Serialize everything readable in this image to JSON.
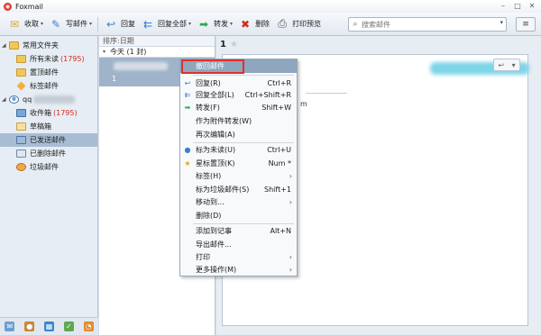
{
  "app": {
    "title": "Foxmail",
    "logo_icon": "foxmail-logo-icon"
  },
  "window_controls": [
    "minimize",
    "maximize",
    "close"
  ],
  "toolbar": {
    "receive": {
      "label": "收取",
      "icon": "receive-icon"
    },
    "compose": {
      "label": "写邮件",
      "icon": "compose-icon"
    },
    "reply": {
      "label": "回复",
      "icon": "reply-icon"
    },
    "reply_all": {
      "label": "回复全部",
      "icon": "reply-all-icon"
    },
    "forward": {
      "label": "转发",
      "icon": "forward-icon"
    },
    "delete": {
      "label": "删除",
      "icon": "delete-icon"
    },
    "print_preview": {
      "label": "打印预览",
      "icon": "print-icon"
    }
  },
  "search": {
    "placeholder": "搜索邮件"
  },
  "sidebar": {
    "common_folder": "常用文件夹",
    "all_unread": "所有未读",
    "all_unread_count": "(1795)",
    "starred": "置顶邮件",
    "tagged": "标签邮件",
    "account_prefix": "qq",
    "inbox": "收件箱",
    "inbox_count": "(1795)",
    "drafts": "草稿箱",
    "sent": "已发送邮件",
    "deleted": "已删除邮件",
    "spam": "垃圾邮件"
  },
  "maillist": {
    "sort_label": "排序:日期",
    "group_label": "今天 (1 封)",
    "item_count": "1"
  },
  "reader": {
    "count": "1",
    "body_fragment": "m"
  },
  "context_menu": {
    "recall": "撤回邮件",
    "items": [
      {
        "label": "回复(R)",
        "shortcut": "Ctrl+R",
        "icon": "reply-icon"
      },
      {
        "label": "回复全部(L)",
        "shortcut": "Ctrl+Shift+R",
        "icon": "reply-all-icon"
      },
      {
        "label": "转发(F)",
        "shortcut": "Shift+W",
        "icon": "forward-icon"
      },
      {
        "label": "作为附件转发(W)",
        "shortcut": "",
        "icon": ""
      },
      {
        "label": "再次编辑(A)",
        "shortcut": "",
        "icon": ""
      },
      {
        "label": "标为未读(U)",
        "shortcut": "Ctrl+U",
        "icon": "unread-dot-icon"
      },
      {
        "label": "星标置顶(K)",
        "shortcut": "Num *",
        "icon": "star-icon"
      },
      {
        "label": "标签(H)",
        "shortcut": "",
        "icon": ""
      },
      {
        "label": "标为垃圾邮件(S)",
        "shortcut": "Shift+1",
        "icon": ""
      },
      {
        "label": "移动到...",
        "shortcut": "",
        "icon": ""
      },
      {
        "label": "删除(D)",
        "shortcut": "",
        "icon": ""
      },
      {
        "label": "添加到记事",
        "shortcut": "Alt+N",
        "icon": ""
      },
      {
        "label": "导出邮件...",
        "shortcut": "",
        "icon": ""
      },
      {
        "label": "打印",
        "shortcut": "",
        "icon": ""
      },
      {
        "label": "更多操作(M)",
        "shortcut": "",
        "icon": ""
      }
    ]
  },
  "colors": {
    "accent": "#8ea6be",
    "highlight_border": "#e0302a",
    "unread": "#d12a1e"
  }
}
